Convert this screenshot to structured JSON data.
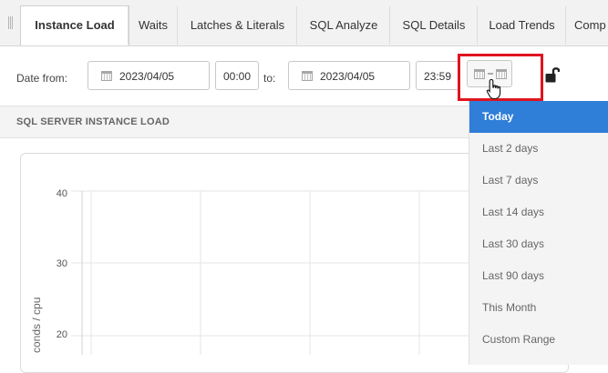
{
  "tabs": [
    {
      "label": "Instance Load",
      "active": true
    },
    {
      "label": "Waits",
      "active": false
    },
    {
      "label": "Latches & Literals",
      "active": false
    },
    {
      "label": "SQL Analyze",
      "active": false
    },
    {
      "label": "SQL Details",
      "active": false
    },
    {
      "label": "Load Trends",
      "active": false
    },
    {
      "label": "Comp",
      "active": false
    }
  ],
  "filter": {
    "date_from_label": "Date from:",
    "from_date": "2023/04/05",
    "from_time": "00:00",
    "to_label": "to:",
    "to_date": "2023/04/05",
    "to_time": "23:59"
  },
  "section": {
    "title": "SQL SERVER INSTANCE LOAD"
  },
  "chart": {
    "y_ticks": [
      "40",
      "30",
      "20"
    ],
    "y_label": "conds / cpu"
  },
  "dropdown": {
    "items": [
      "Today",
      "Last 2 days",
      "Last 7 days",
      "Last 14 days",
      "Last 30 days",
      "Last 90 days",
      "This Month",
      "Custom Range"
    ],
    "selected": "Today"
  },
  "colors": {
    "accent": "#2f7ed8",
    "highlight": "#e0141e",
    "dropdown_bg": "#f4f4f4"
  },
  "icons": {
    "calendar": "calendar-icon",
    "range": "date-range-icon",
    "lock": "unlock-icon",
    "cursor": "hand-pointer-icon"
  }
}
